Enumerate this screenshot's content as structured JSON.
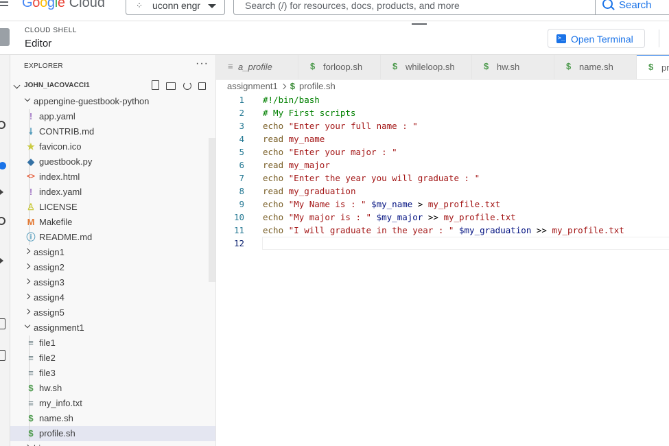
{
  "topbar": {
    "logo_google": "Google",
    "logo_cloud": "Cloud",
    "project_name": "uconn engr",
    "search_placeholder": "Search (/) for resources, docs, products, and more",
    "search_button": "Search"
  },
  "shell": {
    "label": "CLOUD SHELL",
    "mode": "Editor",
    "open_terminal": "Open Terminal"
  },
  "explorer": {
    "title": "EXPLORER",
    "more": "···",
    "workspace": "JOHN_IACOVACCI1",
    "tree": [
      {
        "label": "appengine-guestbook-python",
        "kind": "folder",
        "open": true,
        "depth": 1
      },
      {
        "label": "app.yaml",
        "icon": "!",
        "color": "#a074c4",
        "depth": 2
      },
      {
        "label": "CONTRIB.md",
        "icon": "🠗",
        "color": "#519aba",
        "depth": 2
      },
      {
        "label": "favicon.ico",
        "icon": "★",
        "color": "#cbcb41",
        "depth": 2
      },
      {
        "label": "guestbook.py",
        "icon": "◆",
        "color": "#3572a5",
        "depth": 2
      },
      {
        "label": "index.html",
        "icon": "<>",
        "color": "#e44d26",
        "depth": 2
      },
      {
        "label": "index.yaml",
        "icon": "!",
        "color": "#a074c4",
        "depth": 2
      },
      {
        "label": "LICENSE",
        "icon": "♙",
        "color": "#cbcb41",
        "depth": 2
      },
      {
        "label": "Makefile",
        "icon": "M",
        "color": "#e37933",
        "depth": 2
      },
      {
        "label": "README.md",
        "icon": "ⓘ",
        "color": "#519aba",
        "depth": 2
      },
      {
        "label": "assign1",
        "kind": "folder",
        "open": false,
        "depth": 1
      },
      {
        "label": "assign2",
        "kind": "folder",
        "open": false,
        "depth": 1
      },
      {
        "label": "assign3",
        "kind": "folder",
        "open": false,
        "depth": 1
      },
      {
        "label": "assign4",
        "kind": "folder",
        "open": false,
        "depth": 1
      },
      {
        "label": "assign5",
        "kind": "folder",
        "open": false,
        "depth": 1
      },
      {
        "label": "assignment1",
        "kind": "folder",
        "open": true,
        "depth": 1
      },
      {
        "label": "file1",
        "icon": "≡",
        "color": "#6d8086",
        "depth": 2
      },
      {
        "label": "file2",
        "icon": "≡",
        "color": "#6d8086",
        "depth": 2
      },
      {
        "label": "file3",
        "icon": "≡",
        "color": "#6d8086",
        "depth": 2
      },
      {
        "label": "hw.sh",
        "icon": "$",
        "color": "#4d9a4d",
        "depth": 2
      },
      {
        "label": "my_info.txt",
        "icon": "≡",
        "color": "#6d8086",
        "depth": 2
      },
      {
        "label": "name.sh",
        "icon": "$",
        "color": "#4d9a4d",
        "depth": 2
      },
      {
        "label": "profile.sh",
        "icon": "$",
        "color": "#4d9a4d",
        "depth": 2,
        "selected": true
      },
      {
        "label": "bin",
        "kind": "folder",
        "open": false,
        "depth": 1
      }
    ]
  },
  "tabs": [
    {
      "label": "a_profile",
      "icon": "≡",
      "italic": true
    },
    {
      "label": "forloop.sh",
      "icon": "$"
    },
    {
      "label": "whileloop.sh",
      "icon": "$"
    },
    {
      "label": "hw.sh",
      "icon": "$"
    },
    {
      "label": "name.sh",
      "icon": "$"
    },
    {
      "label": "pro",
      "icon": "$",
      "active": true
    }
  ],
  "breadcrumb": {
    "folder": "assignment1",
    "file": "profile.sh"
  },
  "code": [
    [
      [
        "c-com",
        "#!/bin/bash"
      ]
    ],
    [
      [
        "c-com",
        "# My First scripts"
      ]
    ],
    [
      [
        "c-kw",
        "echo"
      ],
      [
        "c-plain",
        " "
      ],
      [
        "c-str",
        "\"Enter your full name : \""
      ]
    ],
    [
      [
        "c-kw",
        "read"
      ],
      [
        "c-plain",
        " "
      ],
      [
        "c-str",
        "my_name"
      ]
    ],
    [
      [
        "c-kw",
        "echo"
      ],
      [
        "c-plain",
        " "
      ],
      [
        "c-str",
        "\"Enter your major : \""
      ]
    ],
    [
      [
        "c-kw",
        "read"
      ],
      [
        "c-plain",
        " "
      ],
      [
        "c-str",
        "my_major"
      ]
    ],
    [
      [
        "c-kw",
        "echo"
      ],
      [
        "c-plain",
        " "
      ],
      [
        "c-str",
        "\"Enter the year you will graduate : \""
      ]
    ],
    [
      [
        "c-kw",
        "read"
      ],
      [
        "c-plain",
        " "
      ],
      [
        "c-str",
        "my_graduation"
      ]
    ],
    [
      [
        "c-kw",
        "echo"
      ],
      [
        "c-plain",
        " "
      ],
      [
        "c-str",
        "\"My Name is : \""
      ],
      [
        "c-plain",
        " "
      ],
      [
        "c-var",
        "$my_name"
      ],
      [
        "c-plain",
        " > "
      ],
      [
        "c-str",
        "my_profile.txt"
      ]
    ],
    [
      [
        "c-kw",
        "echo"
      ],
      [
        "c-plain",
        " "
      ],
      [
        "c-str",
        "\"My major is : \""
      ],
      [
        "c-plain",
        " "
      ],
      [
        "c-var",
        "$my_major"
      ],
      [
        "c-plain",
        " >> "
      ],
      [
        "c-str",
        "my_profile.txt"
      ]
    ],
    [
      [
        "c-kw",
        "echo"
      ],
      [
        "c-plain",
        " "
      ],
      [
        "c-str",
        "\"I will graduate in the year : \""
      ],
      [
        "c-plain",
        " "
      ],
      [
        "c-var",
        "$my_graduation"
      ],
      [
        "c-plain",
        " >> "
      ],
      [
        "c-str",
        "my_profile.txt"
      ]
    ],
    []
  ]
}
